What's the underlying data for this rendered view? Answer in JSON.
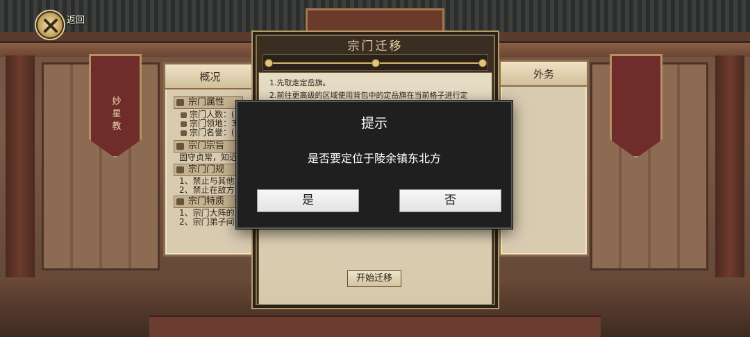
{
  "header": {
    "back_label": "返回"
  },
  "hall": {
    "banner_text": "妙星教"
  },
  "left_panel": {
    "tab_label": "概况",
    "sections": [
      {
        "title": "宗门属性",
        "lines": [
          "宗门人数：(",
          "宗门领地：3",
          "宗门名誉：("
        ]
      },
      {
        "title": "宗门宗旨",
        "lines": [
          "固守贞常，知近"
        ]
      },
      {
        "title": "宗门门规",
        "lines": [
          "1、禁止与其他",
          "2、禁止在敌方"
        ]
      },
      {
        "title": "宗门特质",
        "lines": [
          "1、宗门大阵的",
          "2、宗门弟子间"
        ]
      }
    ]
  },
  "right_panel": {
    "tab_label": "外务"
  },
  "migrate_panel": {
    "title": "宗门迁移",
    "steps": [
      "1.先取走定岳旗。",
      "2.前往更高级的区域使用背包中的定岳旗在当前格子进行定"
    ],
    "start_button": "开始迁移"
  },
  "dialog": {
    "title": "提示",
    "message": "是否要定位于陵余镇东北方",
    "yes_label": "是",
    "no_label": "否"
  },
  "colors": {
    "dialog_bg": "#1f1f1f",
    "button_bg": "#efefef",
    "parchment": "#e6dcc5",
    "banner_red": "#6f2c2a"
  }
}
